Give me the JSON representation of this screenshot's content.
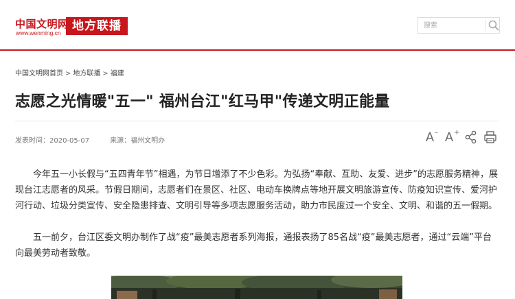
{
  "header": {
    "logo_title": "中国文明网",
    "logo_url": "www.wenming.cn",
    "channel_label": "地方联播",
    "search": {
      "placeholder": "搜索"
    }
  },
  "breadcrumb": {
    "items": [
      "中国文明网首页",
      "地方联播",
      "福建"
    ],
    "separator": ">"
  },
  "article": {
    "title": "志愿之光情暖\"五一\" 福州台江\"红马甲\"传递文明正能量",
    "meta": {
      "date_label": "发表时间：",
      "date": "2020-05-07",
      "source_label": "来源：",
      "source": "福州文明办"
    },
    "tools": {
      "font_decrease_icon": "font-decrease-icon",
      "font_increase_icon": "font-increase-icon",
      "share_icon": "share-icon",
      "print_icon": "print-icon"
    },
    "paragraphs": [
      "今年五一小长假与“五四青年节”相遇，为节日增添了不少色彩。为弘扬“奉献、互助、友爱、进步”的志愿服务精神，展现台江志愿者的风采。节假日期间，志愿者们在景区、社区、电动车换牌点等地开展文明旅游宣传、防疫知识宣传、爱河护河行动、垃圾分类宣传、安全隐患排查、文明引导等多项志愿服务活动，助力市民度过一个安全、文明、和谐的五一假期。",
      "五一前夕，台江区委文明办制作了战“疫”最美志愿者系列海报，通报表扬了85名战“疫”最美志愿者，通过“云端”平台向最美劳动者致敬。"
    ]
  },
  "colors": {
    "brand_red": "#c8161d",
    "text": "#333333",
    "title": "#222222",
    "meta": "#777777"
  }
}
